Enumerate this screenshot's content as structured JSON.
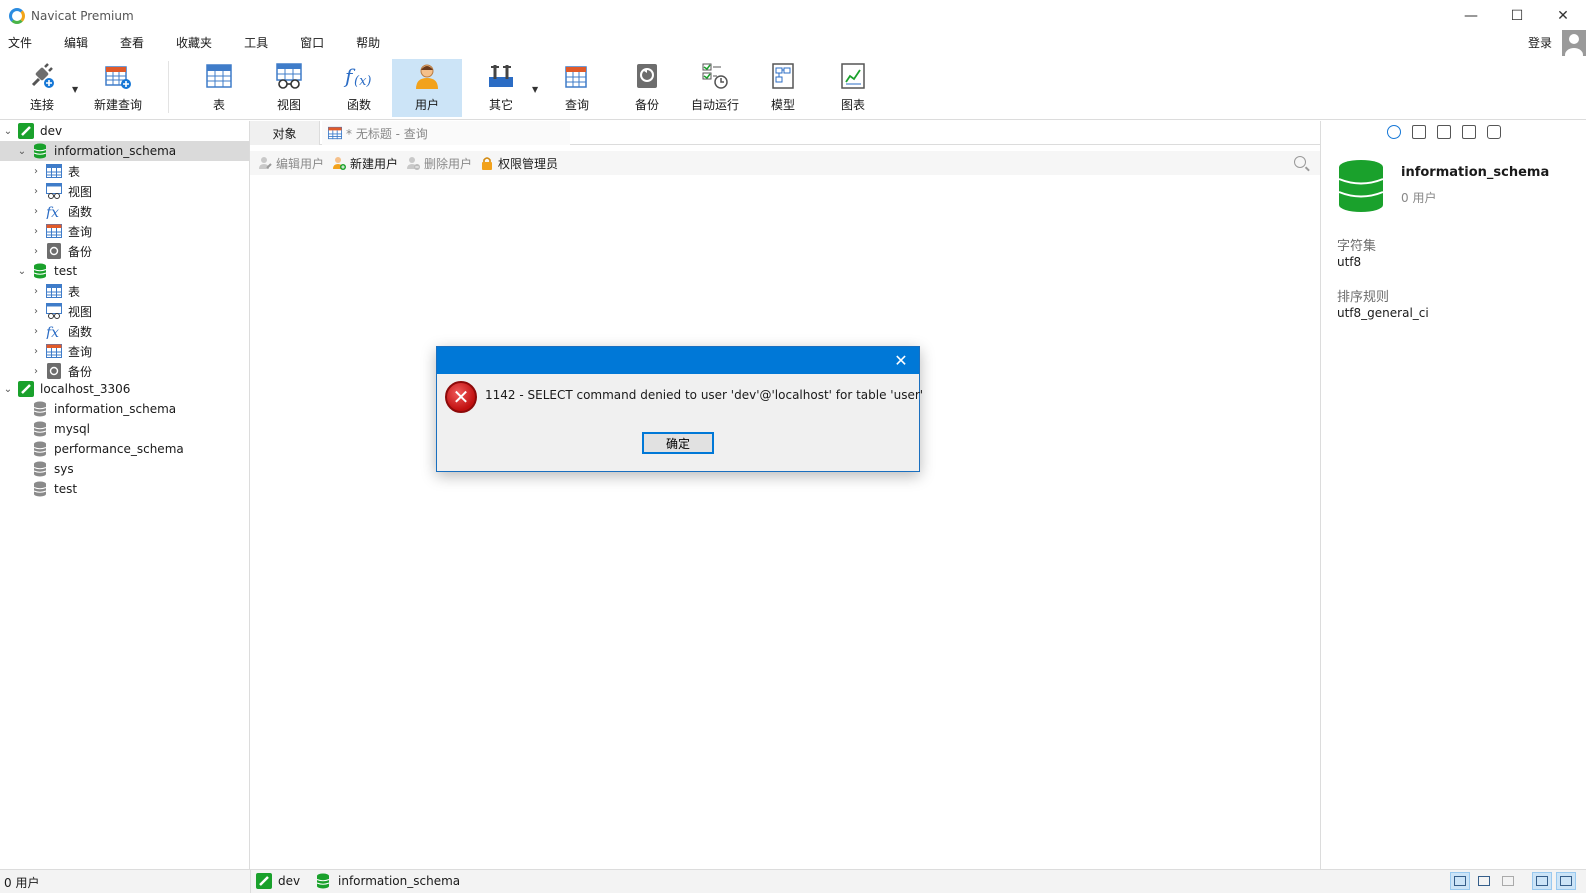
{
  "window": {
    "title": "Navicat Premium",
    "controls": {
      "minimize": "—",
      "maximize": "☐",
      "close": "✕"
    }
  },
  "menu": {
    "items": [
      "文件",
      "编辑",
      "查看",
      "收藏夹",
      "工具",
      "窗口",
      "帮助"
    ],
    "login": "登录"
  },
  "toolbar": {
    "buttons": [
      {
        "label": "连接",
        "icon": "plug-icon"
      },
      {
        "label": "新建查询",
        "icon": "new-query-icon"
      },
      {
        "label": "表",
        "icon": "table-icon"
      },
      {
        "label": "视图",
        "icon": "view-icon"
      },
      {
        "label": "函数",
        "icon": "function-icon"
      },
      {
        "label": "用户",
        "icon": "user-icon",
        "active": true
      },
      {
        "label": "其它",
        "icon": "tools-icon"
      },
      {
        "label": "查询",
        "icon": "query-icon"
      },
      {
        "label": "备份",
        "icon": "backup-icon"
      },
      {
        "label": "自动运行",
        "icon": "schedule-icon"
      },
      {
        "label": "模型",
        "icon": "model-icon"
      },
      {
        "label": "图表",
        "icon": "chart-icon"
      }
    ]
  },
  "tree": {
    "dev": "dev",
    "dev_db1": "information_schema",
    "db_children": [
      "表",
      "视图",
      "函数",
      "查询",
      "备份"
    ],
    "dev_db2": "test",
    "local": "localhost_3306",
    "local_dbs": [
      "information_schema",
      "mysql",
      "performance_schema",
      "sys",
      "test"
    ]
  },
  "tabs": {
    "objects": "对象",
    "query": "* 无标题 - 查询"
  },
  "subtoolbar": {
    "edit_user": "编辑用户",
    "new_user": "新建用户",
    "delete_user": "删除用户",
    "privilege_manager": "权限管理员"
  },
  "info": {
    "db_name": "information_schema",
    "users": "0 用户",
    "charset_label": "字符集",
    "charset_value": "utf8",
    "collation_label": "排序规则",
    "collation_value": "utf8_general_ci"
  },
  "status": {
    "left": "0 用户",
    "connection": "dev",
    "database": "information_schema"
  },
  "dialog": {
    "message": "1142 - SELECT command denied to user 'dev'@'localhost' for table 'user'",
    "ok": "确定",
    "close": "✕"
  },
  "colors": {
    "accent": "#0078d7",
    "db_green": "#1aa12c",
    "error_red": "#c00f0f",
    "selected_bg": "#cce4f7"
  }
}
